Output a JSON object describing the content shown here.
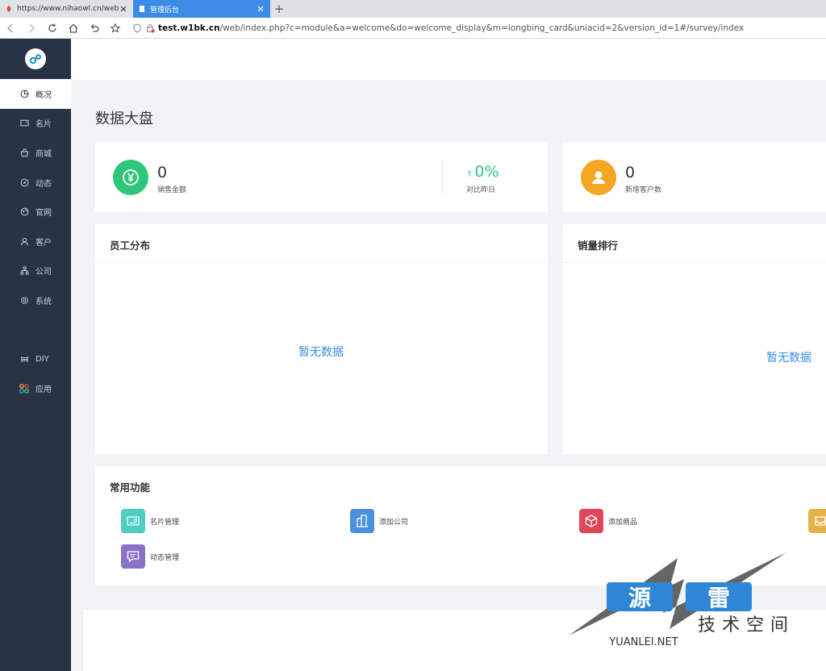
{
  "browser": {
    "tabs": [
      {
        "title": "https://www.nihaowl.cn/web/",
        "active": false
      },
      {
        "title": "管理后台",
        "active": true
      }
    ],
    "new_tab": "+",
    "url_host": "test.w1bk.cn",
    "url_rest": "/web/index.php?c=module&a=welcome&do=welcome_display&m=longbing_card&uniacid=2&version_id=1#/survey/index"
  },
  "sidebar": {
    "items": [
      {
        "label": "概况",
        "icon": "pie-chart-icon",
        "active": true
      },
      {
        "label": "名片",
        "icon": "card-icon",
        "active": false
      },
      {
        "label": "商城",
        "icon": "shop-icon",
        "active": false
      },
      {
        "label": "动态",
        "icon": "compass-icon",
        "active": false
      },
      {
        "label": "官网",
        "icon": "globe-icon",
        "active": false
      },
      {
        "label": "客户",
        "icon": "user-icon",
        "active": false
      },
      {
        "label": "公司",
        "icon": "org-icon",
        "active": false
      },
      {
        "label": "系统",
        "icon": "gear-icon",
        "active": false
      }
    ],
    "extra": [
      {
        "label": "DIY",
        "icon": "diy-icon"
      },
      {
        "label": "应用",
        "icon": "apps-icon"
      }
    ]
  },
  "main": {
    "title": "数据大盘",
    "stats": {
      "sales_value": "0",
      "sales_label": "销售金额",
      "compare_value": "0%",
      "compare_arrow": "↑",
      "compare_label": "对比昨日",
      "customers_value": "0",
      "customers_label": "新增客户数"
    },
    "panels": {
      "staff_title": "员工分布",
      "staff_empty": "暂无数据",
      "rank_title": "销量排行",
      "rank_empty": "暂无数据"
    },
    "functions": {
      "title": "常用功能",
      "items": [
        {
          "label": "名片管理",
          "color": "#4ccfc0"
        },
        {
          "label": "添加公司",
          "color": "#4a8fe0"
        },
        {
          "label": "添加商品",
          "color": "#e0465a"
        },
        {
          "label": "动态管理",
          "color": "#8a72c8"
        }
      ]
    }
  },
  "watermark": {
    "char1": "源",
    "char2": "雷",
    "subtitle": "技术空间",
    "domain": "YUANLEI.NET"
  },
  "colors": {
    "sidebar_bg": "#283443",
    "accent_green": "#2ec77a",
    "accent_orange": "#f5a623",
    "link_blue": "#3a8ee6"
  }
}
